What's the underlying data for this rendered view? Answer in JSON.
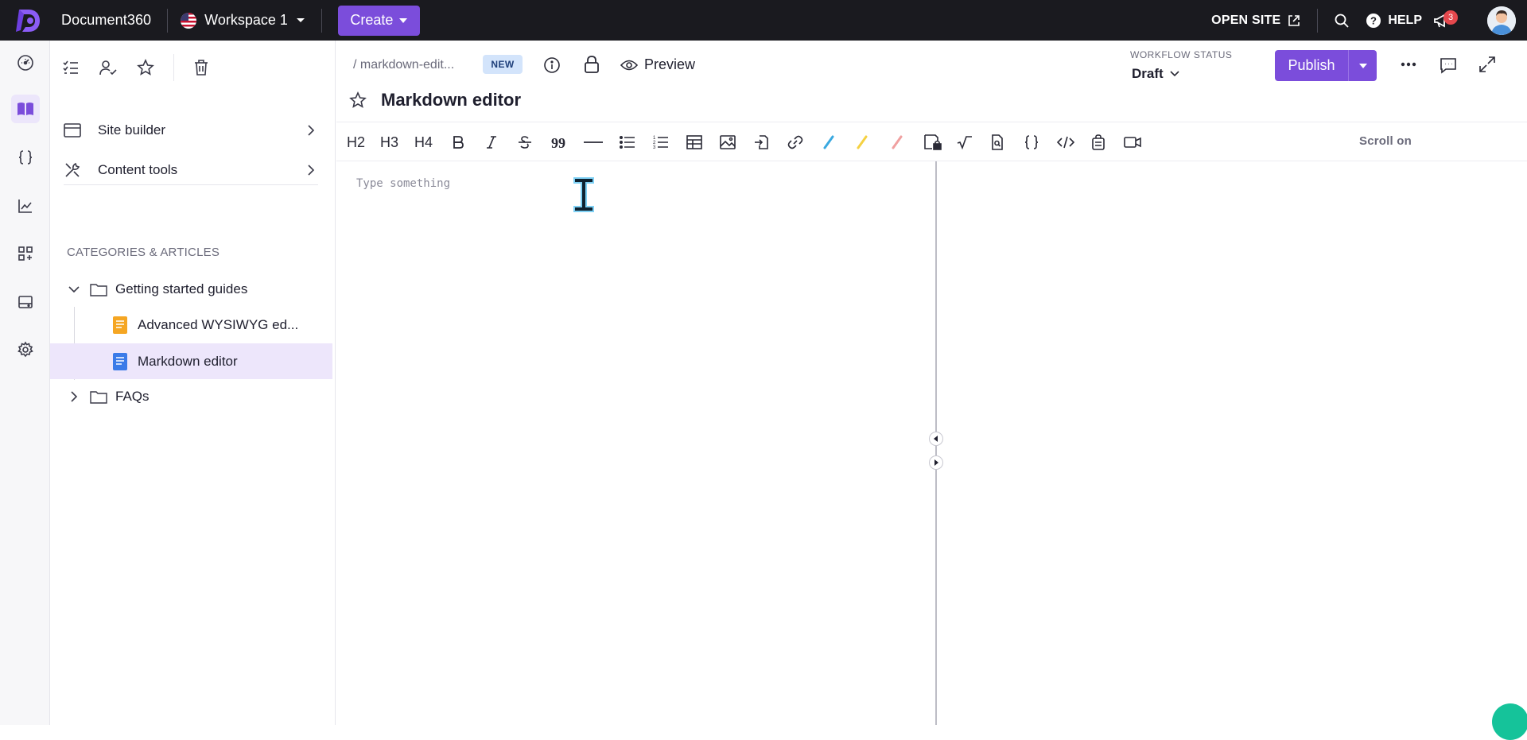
{
  "topbar": {
    "brand": "Document360",
    "workspace": "Workspace 1",
    "create_label": "Create",
    "open_site_label": "OPEN SITE",
    "help_label": "HELP",
    "notification_count": "3"
  },
  "sidebar": {
    "tools": [
      "checklist-icon",
      "user-check-icon",
      "star-icon",
      "trash-icon"
    ],
    "site_builder": "Site builder",
    "content_tools": "Content tools",
    "categories_heading": "CATEGORIES & ARTICLES",
    "tree": [
      {
        "label": "Getting started guides",
        "type": "folder",
        "expanded": true
      },
      {
        "label": "Advanced WYSIWYG ed...",
        "type": "article",
        "color": "#f5a623"
      },
      {
        "label": "Markdown editor",
        "type": "article",
        "color": "#3b7be8",
        "selected": true
      },
      {
        "label": "FAQs",
        "type": "folder",
        "expanded": false
      }
    ]
  },
  "editor": {
    "breadcrumb": "/ markdown-edit...",
    "new_badge": "NEW",
    "preview_label": "Preview",
    "workflow_label": "WORKFLOW STATUS",
    "workflow_value": "Draft",
    "publish_label": "Publish",
    "title": "Markdown editor",
    "toolbar": {
      "h2": "H2",
      "h3": "H3",
      "h4": "H4",
      "scroll_label": "Scroll on"
    },
    "placeholder": "Type something"
  },
  "colors": {
    "accent": "#7b4ddb",
    "topbar": "#1a1a1f",
    "selected_row": "#ede6fb"
  }
}
